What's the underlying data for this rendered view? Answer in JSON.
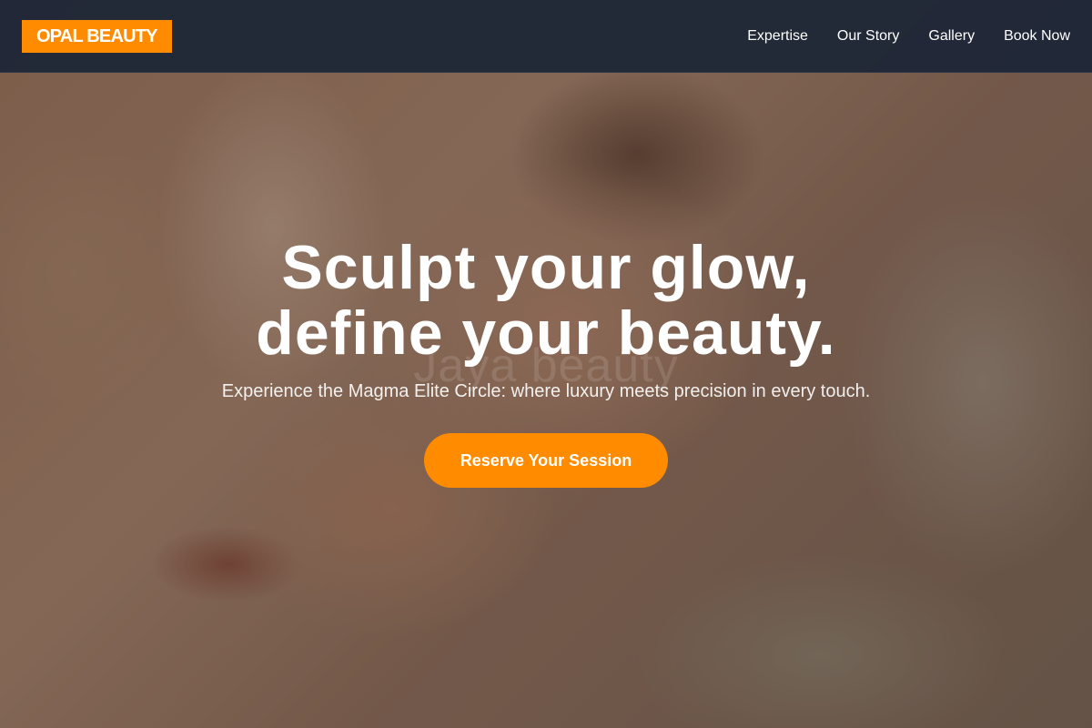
{
  "header": {
    "logo_text": "OPAL BEAUTY",
    "nav": [
      {
        "label": "Expertise"
      },
      {
        "label": "Our Story"
      },
      {
        "label": "Gallery"
      },
      {
        "label": "Book Now"
      }
    ]
  },
  "hero": {
    "headline_line1": "Sculpt your glow,",
    "headline_line2": "define your beauty.",
    "subtitle": "Experience the Magma Elite Circle: where luxury meets precision in every touch.",
    "cta_label": "Reserve Your Session",
    "watermark": "Jaya beauty"
  },
  "colors": {
    "accent": "#ff8c00",
    "header_bg": "#1e2636",
    "text": "#ffffff"
  }
}
